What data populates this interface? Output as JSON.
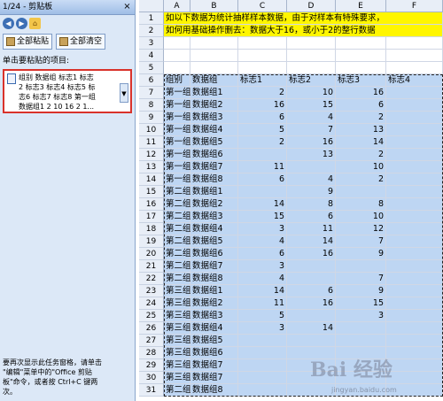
{
  "pane": {
    "title": "1/24 - 剪贴板",
    "close_glyph": "×",
    "nav": [
      "◀",
      "▶",
      "⌂"
    ],
    "paste_all_label": "全部粘贴",
    "clear_all_label": "全部清空",
    "instruction": "单击要粘贴的项目:",
    "clip_text": [
      "组别 数据组 标志1 标志",
      "2 标志3 标志4 标志5 标",
      "志6 标志7 标志8 第一组",
      "数据组1 2 10 16 2 1..."
    ],
    "hint_lines": [
      "要再次显示此任务窗格，请单击",
      "\"编辑\"菜单中的\"Office 剪贴",
      "板\"命令，或者按 Ctrl+C 键两",
      "次。"
    ]
  },
  "sheet": {
    "columns": [
      "A",
      "B",
      "C",
      "D",
      "E",
      "F"
    ],
    "note_rows": {
      "1": "如以下数据为统计抽样样本数据，由于对样本有特殊要求，",
      "2": "如何用基础操作删去：数据大于16，或小于2的整行数据"
    },
    "header_row": [
      "组别",
      "数据组",
      "标志1",
      "标志2",
      "标志3",
      "标志4"
    ],
    "rows": [
      {
        "n": "7",
        "a": "第一组",
        "b": "数据组1",
        "c": "2",
        "d": "10",
        "e": "16"
      },
      {
        "n": "8",
        "a": "第一组",
        "b": "数据组2",
        "c": "16",
        "d": "15",
        "e": "6"
      },
      {
        "n": "9",
        "a": "第一组",
        "b": "数据组3",
        "c": "6",
        "d": "4",
        "e": "2"
      },
      {
        "n": "10",
        "a": "第一组",
        "b": "数据组4",
        "c": "5",
        "d": "7",
        "e": "13"
      },
      {
        "n": "11",
        "a": "第一组",
        "b": "数据组5",
        "c": "2",
        "d": "16",
        "e": "14"
      },
      {
        "n": "12",
        "a": "第一组",
        "b": "数据组6",
        "c": "",
        "d": "13",
        "e": "2"
      },
      {
        "n": "13",
        "a": "第一组",
        "b": "数据组7",
        "c": "11",
        "d": "",
        "e": "10"
      },
      {
        "n": "14",
        "a": "第一组",
        "b": "数据组8",
        "c": "6",
        "d": "4",
        "e": "2"
      },
      {
        "n": "15",
        "a": "第二组",
        "b": "数据组1",
        "c": "",
        "d": "9",
        "e": ""
      },
      {
        "n": "16",
        "a": "第二组",
        "b": "数据组2",
        "c": "14",
        "d": "8",
        "e": "8"
      },
      {
        "n": "17",
        "a": "第二组",
        "b": "数据组3",
        "c": "15",
        "d": "6",
        "e": "10"
      },
      {
        "n": "18",
        "a": "第二组",
        "b": "数据组4",
        "c": "3",
        "d": "11",
        "e": "12"
      },
      {
        "n": "19",
        "a": "第二组",
        "b": "数据组5",
        "c": "4",
        "d": "14",
        "e": "7"
      },
      {
        "n": "20",
        "a": "第二组",
        "b": "数据组6",
        "c": "6",
        "d": "16",
        "e": "9"
      },
      {
        "n": "21",
        "a": "第二组",
        "b": "数据组7",
        "c": "3",
        "d": "",
        "e": ""
      },
      {
        "n": "22",
        "a": "第二组",
        "b": "数据组8",
        "c": "4",
        "d": "",
        "e": "7"
      },
      {
        "n": "23",
        "a": "第三组",
        "b": "数据组1",
        "c": "14",
        "d": "6",
        "e": "9"
      },
      {
        "n": "24",
        "a": "第三组",
        "b": "数据组2",
        "c": "11",
        "d": "16",
        "e": "15"
      },
      {
        "n": "25",
        "a": "第三组",
        "b": "数据组3",
        "c": "5",
        "d": "",
        "e": "3"
      },
      {
        "n": "26",
        "a": "第三组",
        "b": "数据组4",
        "c": "3",
        "d": "14",
        "e": ""
      },
      {
        "n": "27",
        "a": "第三组",
        "b": "数据组5",
        "c": "",
        "d": "",
        "e": ""
      },
      {
        "n": "28",
        "a": "第三组",
        "b": "数据组6",
        "c": "",
        "d": "",
        "e": ""
      },
      {
        "n": "29",
        "a": "第三组",
        "b": "数据组7",
        "c": "",
        "d": "",
        "e": ""
      },
      {
        "n": "30",
        "a": "第三组",
        "b": "数据组7",
        "c": "",
        "d": "",
        "e": ""
      },
      {
        "n": "31",
        "a": "第二组",
        "b": "数据组8",
        "c": "",
        "d": "",
        "e": ""
      }
    ]
  },
  "watermark": {
    "logo": "Bai 经验",
    "url": "jingyan.baidu.com"
  },
  "colors": {
    "selection": "#bed6f3",
    "note_fill": "#fff600",
    "highlight_border": "#d9322b"
  }
}
